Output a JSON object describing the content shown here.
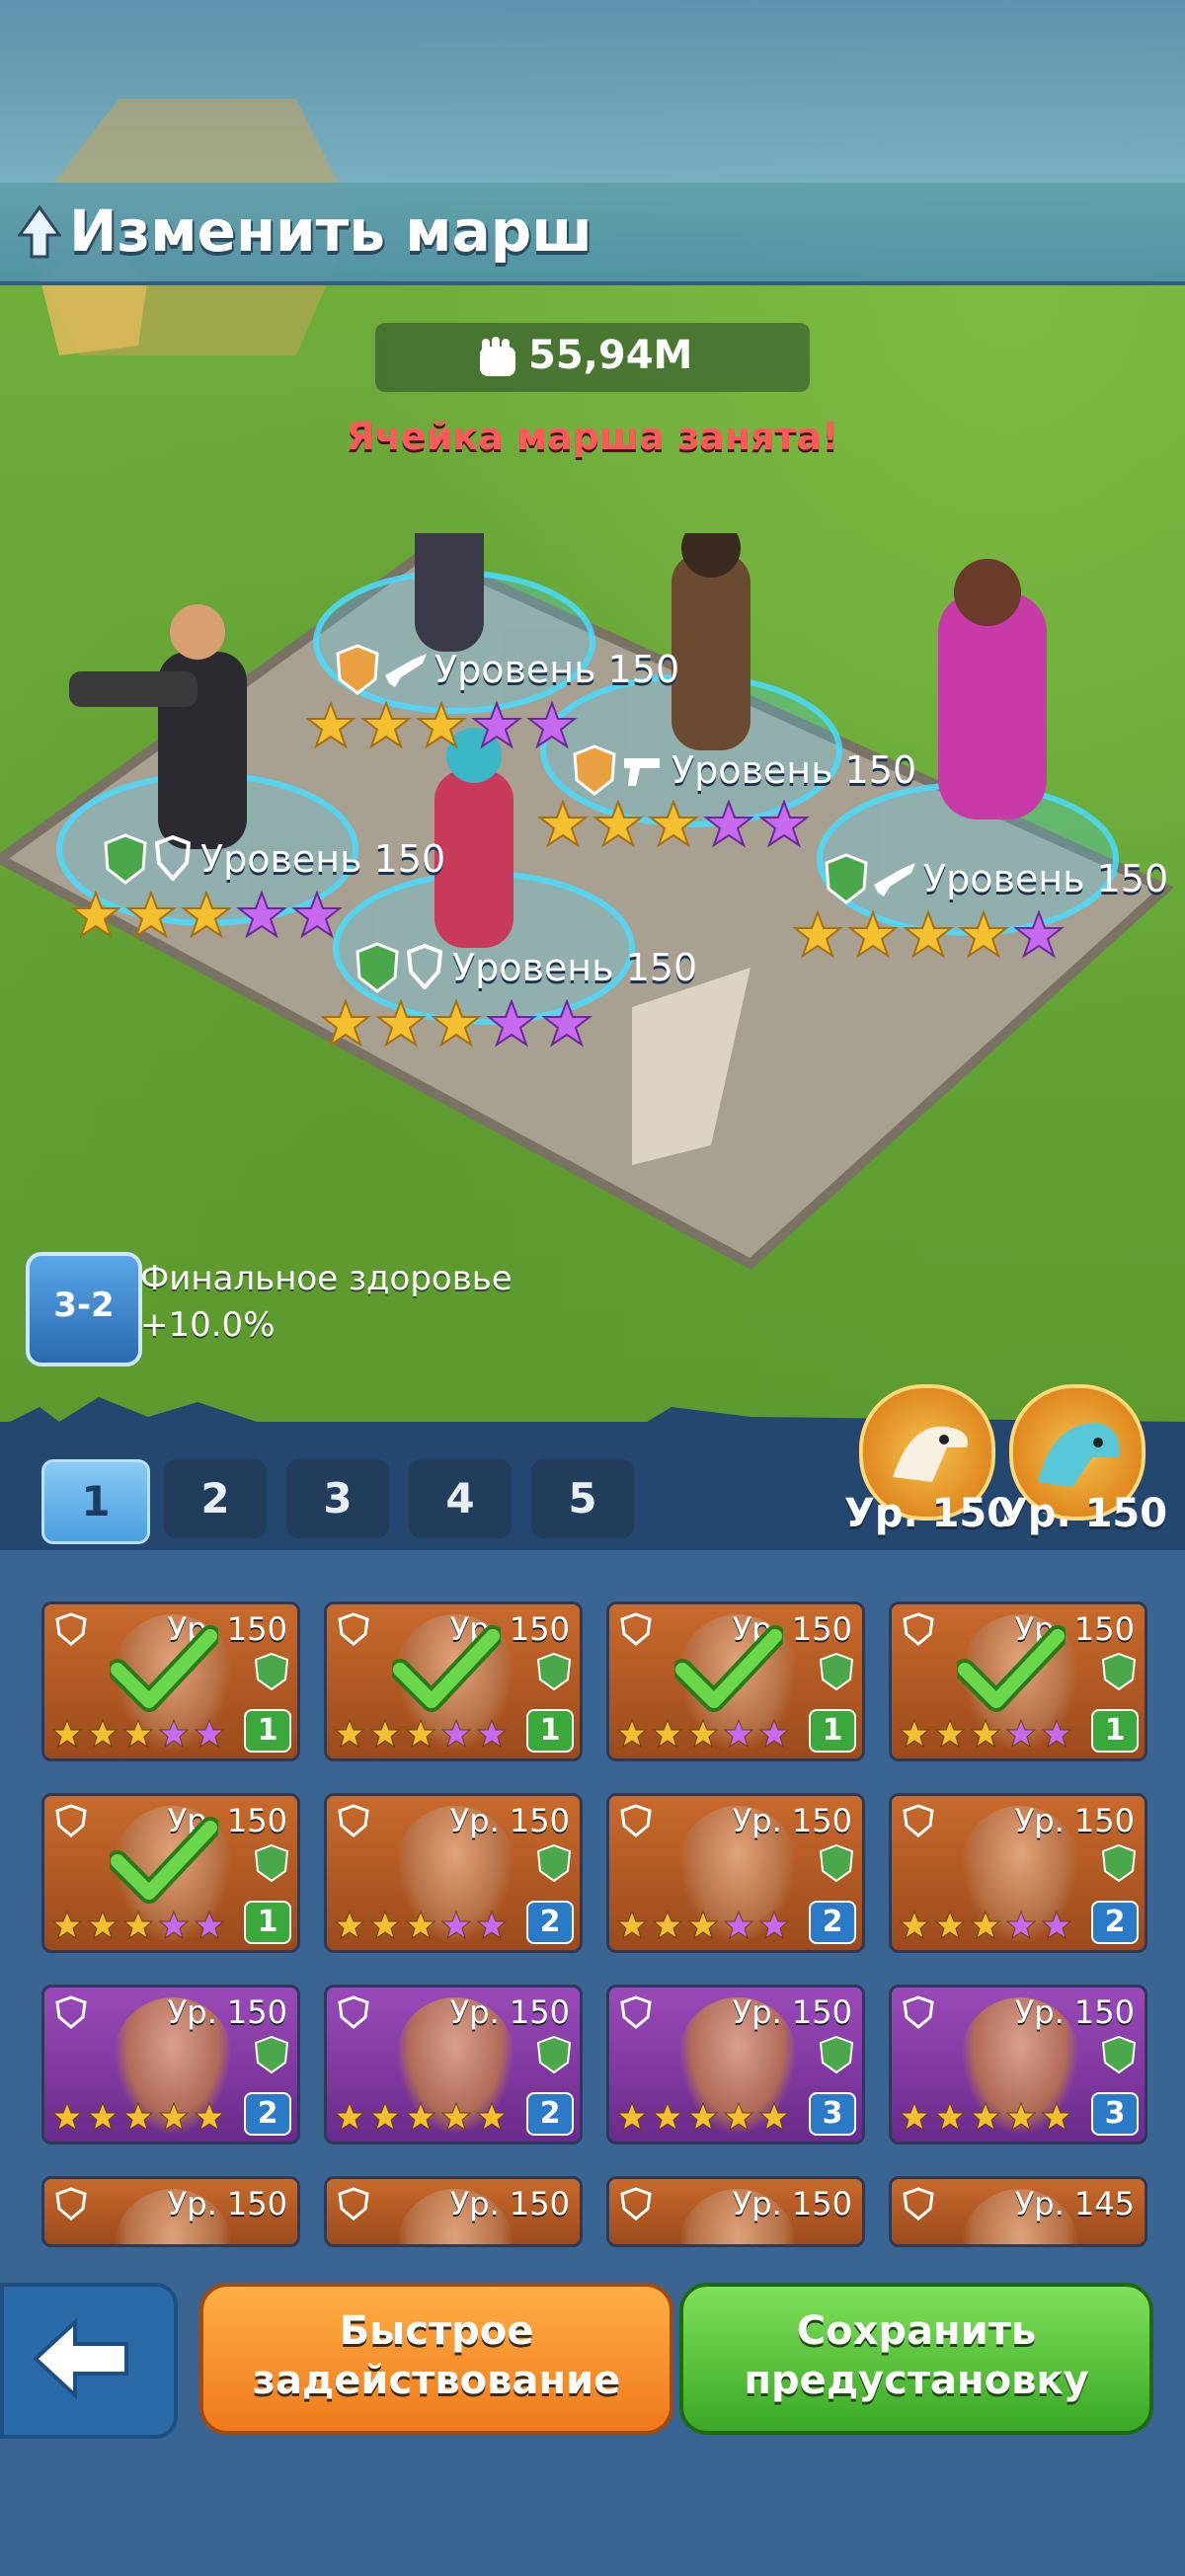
{
  "header": {
    "title": "Изменить марш"
  },
  "power": {
    "value": "55,94M"
  },
  "warning": "Ячейка марша занята!",
  "board": {
    "heroes": [
      {
        "level": "Уровень 150",
        "faction": "desert",
        "class": "rifle",
        "stars_gold": 3,
        "stars_purple": 2
      },
      {
        "level": "Уровень 150",
        "faction": "desert",
        "class": "pistol",
        "stars_gold": 3,
        "stars_purple": 2
      },
      {
        "level": "Уровень 150",
        "faction": "forest",
        "class": "shield",
        "stars_gold": 3,
        "stars_purple": 2
      },
      {
        "level": "Уровень 150",
        "faction": "forest",
        "class": "rifle",
        "stars_gold": 4,
        "stars_purple": 1
      },
      {
        "level": "Уровень 150",
        "faction": "forest",
        "class": "shield",
        "stars_gold": 3,
        "stars_purple": 2
      }
    ]
  },
  "bonus": {
    "icon_text": "3-2",
    "name": "Финальное здоровье",
    "value": "+10.0%"
  },
  "tabs": [
    "1",
    "2",
    "3",
    "4",
    "5"
  ],
  "active_tab": "1",
  "pets": [
    {
      "name": "eagle-pet",
      "level": "Ур. 150"
    },
    {
      "name": "dragon-pet",
      "level": "Ур. 150"
    }
  ],
  "roster": [
    {
      "level": "Ур. 150",
      "bg": "orange",
      "count": "1",
      "count_color": "g",
      "checked": true
    },
    {
      "level": "Ур. 150",
      "bg": "orange",
      "count": "1",
      "count_color": "g",
      "checked": true
    },
    {
      "level": "Ур. 150",
      "bg": "orange",
      "count": "1",
      "count_color": "g",
      "checked": true
    },
    {
      "level": "Ур. 150",
      "bg": "orange",
      "count": "1",
      "count_color": "g",
      "checked": true
    },
    {
      "level": "Ур. 150",
      "bg": "orange",
      "count": "1",
      "count_color": "g",
      "checked": true
    },
    {
      "level": "Ур. 150",
      "bg": "orange",
      "count": "2",
      "count_color": "b",
      "checked": false
    },
    {
      "level": "Ур. 150",
      "bg": "orange",
      "count": "2",
      "count_color": "b",
      "checked": false
    },
    {
      "level": "Ур. 150",
      "bg": "orange",
      "count": "2",
      "count_color": "b",
      "checked": false
    },
    {
      "level": "Ур. 150",
      "bg": "purple",
      "count": "2",
      "count_color": "b",
      "checked": false
    },
    {
      "level": "Ур. 150",
      "bg": "purple",
      "count": "2",
      "count_color": "b",
      "checked": false
    },
    {
      "level": "Ур. 150",
      "bg": "purple",
      "count": "3",
      "count_color": "b",
      "checked": false
    },
    {
      "level": "Ур. 150",
      "bg": "purple",
      "count": "3",
      "count_color": "b",
      "checked": false
    },
    {
      "level": "Ур. 150",
      "bg": "orange",
      "count": "",
      "count_color": "b",
      "checked": false
    },
    {
      "level": "Ур. 150",
      "bg": "orange",
      "count": "",
      "count_color": "b",
      "checked": false
    },
    {
      "level": "Ур. 150",
      "bg": "orange",
      "count": "",
      "count_color": "b",
      "checked": false
    },
    {
      "level": "Ур. 145",
      "bg": "orange",
      "count": "",
      "count_color": "b",
      "checked": false
    }
  ],
  "buttons": {
    "quick_deploy": "Быстрое задействование",
    "save_preset": "Сохранить предустановку"
  }
}
